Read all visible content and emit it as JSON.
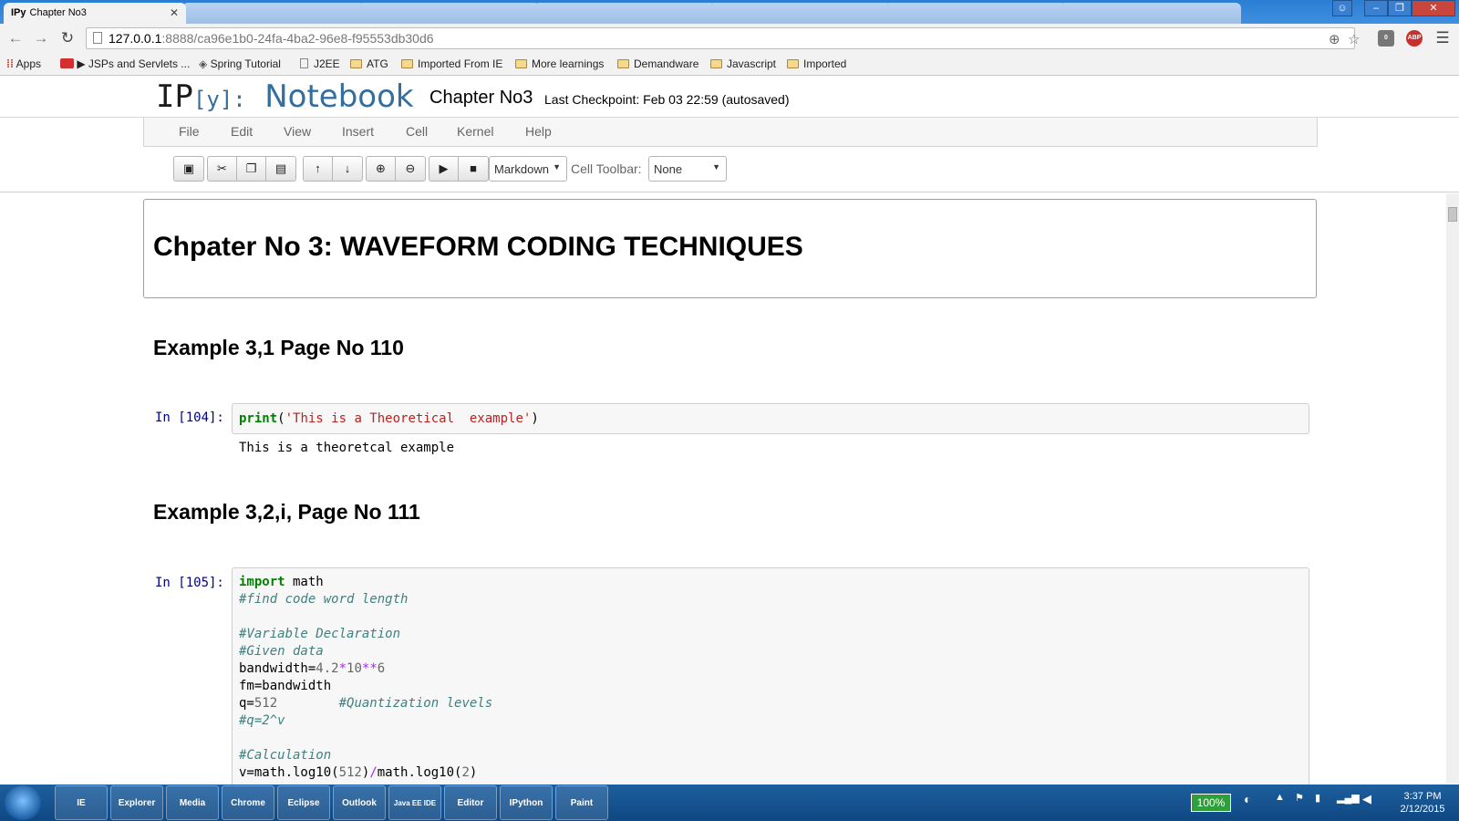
{
  "browser": {
    "tabs": [
      {
        "label": "Chapter No3",
        "favicon": "IPy"
      },
      {
        "label": ""
      },
      {
        "label": ""
      },
      {
        "label": ""
      },
      {
        "label": ""
      },
      {
        "label": ""
      },
      {
        "label": ""
      }
    ],
    "url_host": "127.0.0.1",
    "url_path": ":8888/ca96e1b0-24fa-4ba2-96e8-f95553db30d6",
    "extensions": [
      "ABP"
    ],
    "ext_badge": "0"
  },
  "bookmarks": [
    {
      "label": "Apps",
      "icon": "apps-grid-icon"
    },
    {
      "label": "JSPs and Servlets ...",
      "icon": "youtube-icon"
    },
    {
      "label": "Spring Tutorial",
      "icon": "spring-icon"
    },
    {
      "label": "J2EE",
      "icon": "page-icon"
    },
    {
      "label": "ATG",
      "icon": "folder-icon"
    },
    {
      "label": "Imported From IE",
      "icon": "folder-icon"
    },
    {
      "label": "More learnings",
      "icon": "folder-icon"
    },
    {
      "label": "Demandware",
      "icon": "folder-icon"
    },
    {
      "label": "Javascript",
      "icon": "folder-icon"
    },
    {
      "label": "Imported",
      "icon": "folder-icon"
    }
  ],
  "notebook": {
    "logo_ip": "IP",
    "logo_y": "[y]:",
    "logo_nb": "Notebook",
    "name": "Chapter No3",
    "checkpoint": "Last Checkpoint: Feb 03 22:59 (autosaved)",
    "menu": [
      "File",
      "Edit",
      "View",
      "Insert",
      "Cell",
      "Kernel",
      "Help"
    ],
    "cell_type": "Markdown",
    "cell_toolbar_label": "Cell Toolbar:",
    "cell_toolbar_value": "None"
  },
  "cells": {
    "h1": "Chpater No 3: WAVEFORM CODING TECHNIQUES",
    "h2_a": "Example 3,1 Page No 110",
    "prompt_a": "In [104]:",
    "output_a": "This is a theoretcal example",
    "h2_b": "Example 3,2,i, Page No 111",
    "prompt_b": "In [105]:"
  },
  "taskbar": {
    "items": [
      "IE",
      "Explorer",
      "Media",
      "Chrome",
      "Eclipse",
      "Outlook",
      "Java EE IDE",
      "Editor",
      "IPython",
      "Paint"
    ],
    "battery": "100%",
    "time": "3:37 PM",
    "date": "2/12/2015"
  }
}
